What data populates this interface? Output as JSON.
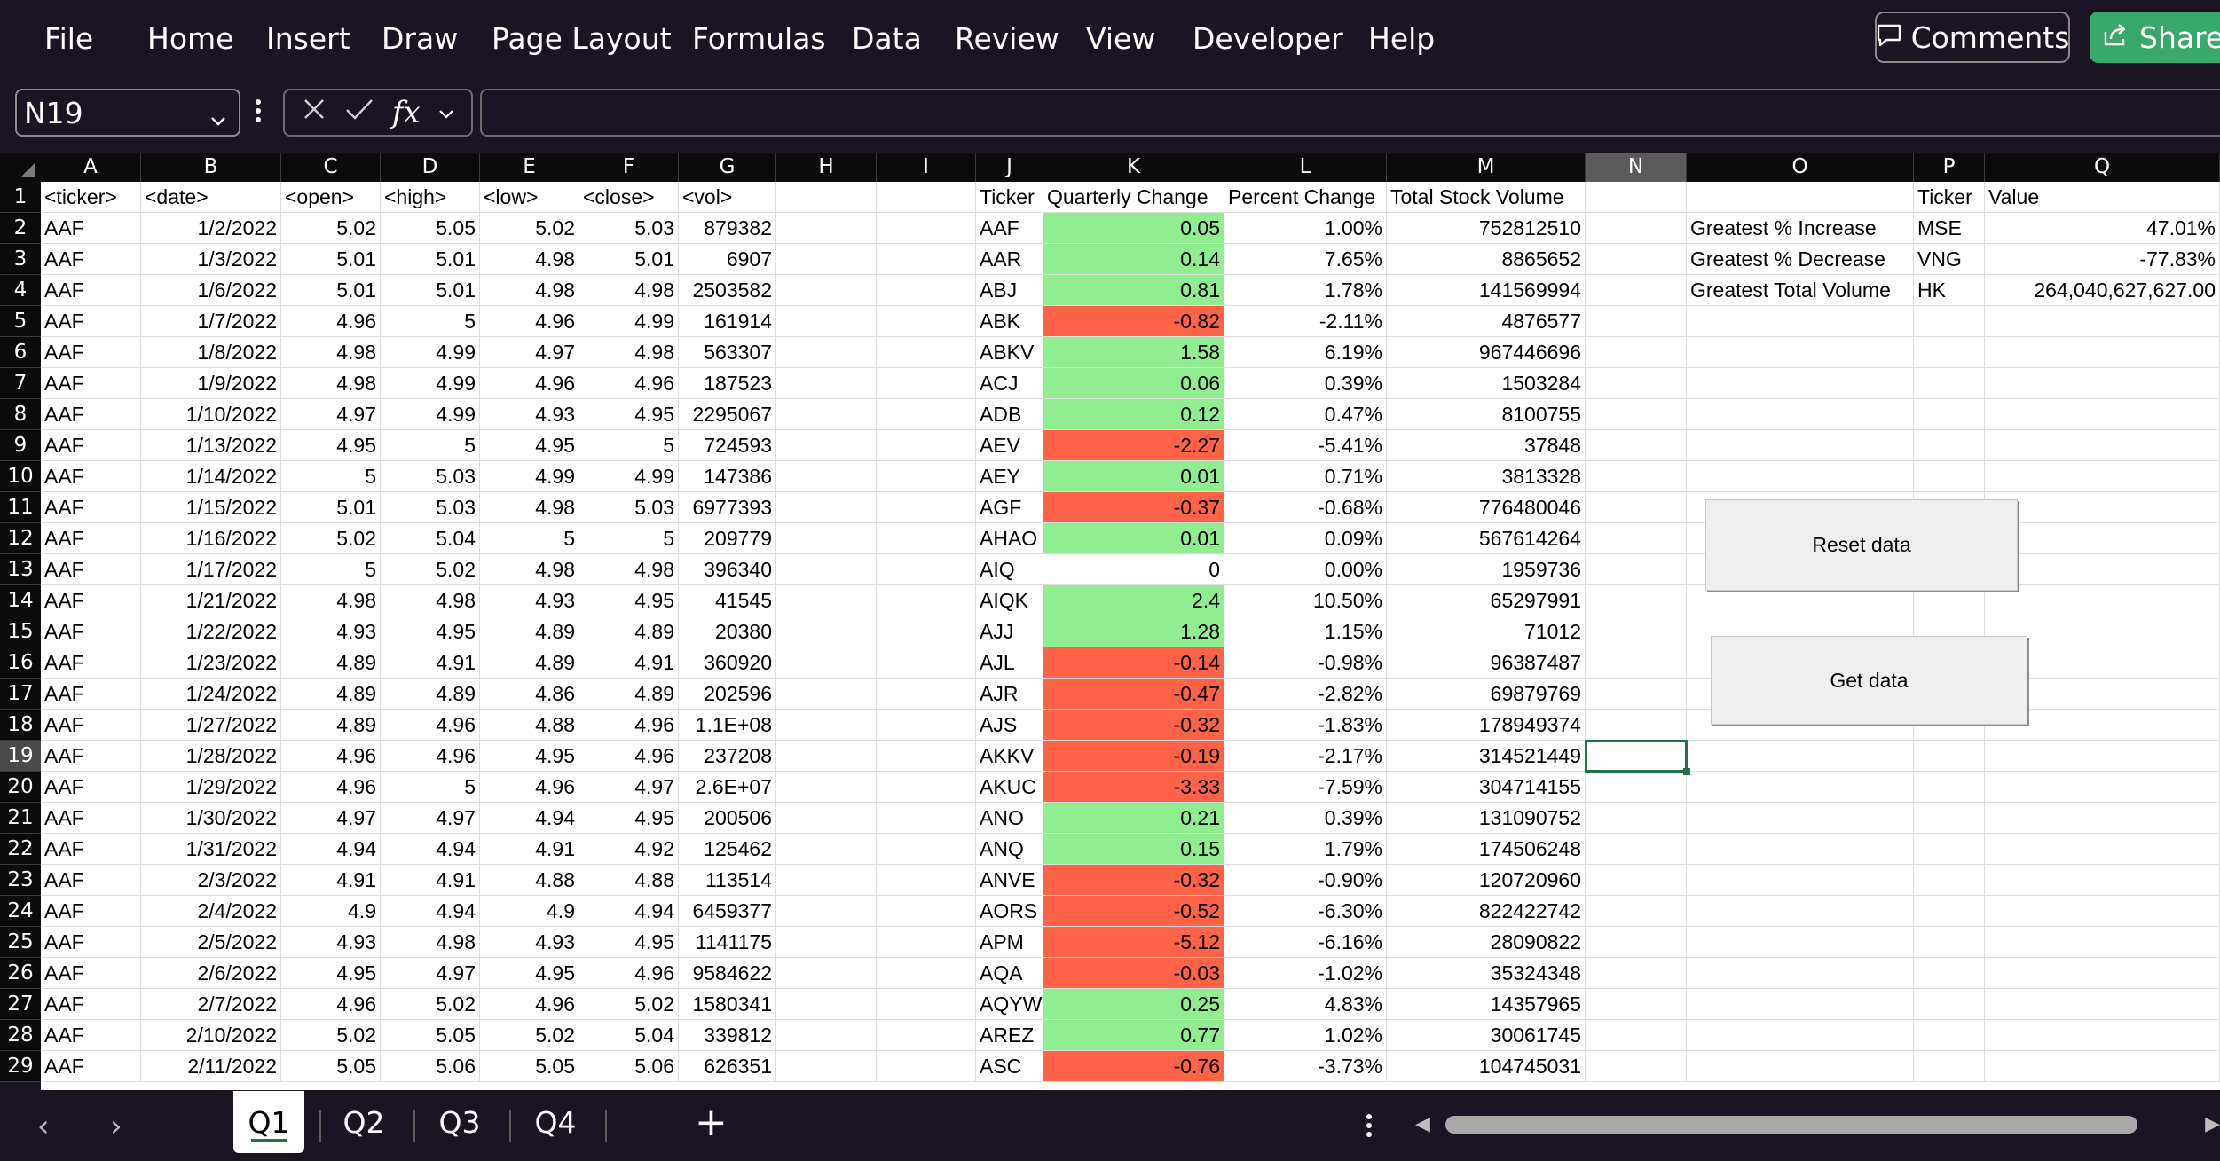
{
  "menu": [
    "File",
    "Home",
    "Insert",
    "Draw",
    "Page Layout",
    "Formulas",
    "Data",
    "Review",
    "View",
    "Developer",
    "Help"
  ],
  "comments_label": "Comments",
  "share_label": "Share",
  "namebox": "N19",
  "formula_value": "",
  "columns": [
    "A",
    "B",
    "C",
    "D",
    "E",
    "F",
    "G",
    "H",
    "I",
    "J",
    "K",
    "L",
    "M",
    "N",
    "O",
    "P",
    "Q"
  ],
  "selected_column": "N",
  "selected_row": 19,
  "rows": [
    {
      "n": 1,
      "A": "<ticker>",
      "B": "<date>",
      "C": "<open>",
      "D": "<high>",
      "E": "<low>",
      "F": "<close>",
      "G": "<vol>",
      "J": "Ticker",
      "K": "Quarterly Change",
      "L": "Percent Change",
      "M": "Total Stock Volume",
      "P": "Ticker",
      "Q": "Value"
    },
    {
      "n": 2,
      "A": "AAF",
      "B": "1/2/2022",
      "C": "5.02",
      "D": "5.05",
      "E": "5.02",
      "F": "5.03",
      "G": "879382",
      "J": "AAF",
      "K": "0.05",
      "L": "1.00%",
      "M": "752812510",
      "O": "Greatest % Increase",
      "P": "MSE",
      "Q": "47.01%"
    },
    {
      "n": 3,
      "A": "AAF",
      "B": "1/3/2022",
      "C": "5.01",
      "D": "5.01",
      "E": "4.98",
      "F": "5.01",
      "G": "6907",
      "J": "AAR",
      "K": "0.14",
      "L": "7.65%",
      "M": "8865652",
      "O": "Greatest % Decrease",
      "P": "VNG",
      "Q": "-77.83%"
    },
    {
      "n": 4,
      "A": "AAF",
      "B": "1/6/2022",
      "C": "5.01",
      "D": "5.01",
      "E": "4.98",
      "F": "4.98",
      "G": "2503582",
      "J": "ABJ",
      "K": "0.81",
      "L": "1.78%",
      "M": "141569994",
      "O": "Greatest Total Volume",
      "P": "HK",
      "Q": "264,040,627,627.00"
    },
    {
      "n": 5,
      "A": "AAF",
      "B": "1/7/2022",
      "C": "4.96",
      "D": "5",
      "E": "4.96",
      "F": "4.99",
      "G": "161914",
      "J": "ABK",
      "K": "-0.82",
      "L": "-2.11%",
      "M": "4876577"
    },
    {
      "n": 6,
      "A": "AAF",
      "B": "1/8/2022",
      "C": "4.98",
      "D": "4.99",
      "E": "4.97",
      "F": "4.98",
      "G": "563307",
      "J": "ABKV",
      "K": "1.58",
      "L": "6.19%",
      "M": "967446696"
    },
    {
      "n": 7,
      "A": "AAF",
      "B": "1/9/2022",
      "C": "4.98",
      "D": "4.99",
      "E": "4.96",
      "F": "4.96",
      "G": "187523",
      "J": "ACJ",
      "K": "0.06",
      "L": "0.39%",
      "M": "1503284"
    },
    {
      "n": 8,
      "A": "AAF",
      "B": "1/10/2022",
      "C": "4.97",
      "D": "4.99",
      "E": "4.93",
      "F": "4.95",
      "G": "2295067",
      "J": "ADB",
      "K": "0.12",
      "L": "0.47%",
      "M": "8100755"
    },
    {
      "n": 9,
      "A": "AAF",
      "B": "1/13/2022",
      "C": "4.95",
      "D": "5",
      "E": "4.95",
      "F": "5",
      "G": "724593",
      "J": "AEV",
      "K": "-2.27",
      "L": "-5.41%",
      "M": "37848"
    },
    {
      "n": 10,
      "A": "AAF",
      "B": "1/14/2022",
      "C": "5",
      "D": "5.03",
      "E": "4.99",
      "F": "4.99",
      "G": "147386",
      "J": "AEY",
      "K": "0.01",
      "L": "0.71%",
      "M": "3813328"
    },
    {
      "n": 11,
      "A": "AAF",
      "B": "1/15/2022",
      "C": "5.01",
      "D": "5.03",
      "E": "4.98",
      "F": "5.03",
      "G": "6977393",
      "J": "AGF",
      "K": "-0.37",
      "L": "-0.68%",
      "M": "776480046"
    },
    {
      "n": 12,
      "A": "AAF",
      "B": "1/16/2022",
      "C": "5.02",
      "D": "5.04",
      "E": "5",
      "F": "5",
      "G": "209779",
      "J": "AHAO",
      "K": "0.01",
      "L": "0.09%",
      "M": "567614264"
    },
    {
      "n": 13,
      "A": "AAF",
      "B": "1/17/2022",
      "C": "5",
      "D": "5.02",
      "E": "4.98",
      "F": "4.98",
      "G": "396340",
      "J": "AIQ",
      "K": "0",
      "L": "0.00%",
      "M": "1959736"
    },
    {
      "n": 14,
      "A": "AAF",
      "B": "1/21/2022",
      "C": "4.98",
      "D": "4.98",
      "E": "4.93",
      "F": "4.95",
      "G": "41545",
      "J": "AIQK",
      "K": "2.4",
      "L": "10.50%",
      "M": "65297991"
    },
    {
      "n": 15,
      "A": "AAF",
      "B": "1/22/2022",
      "C": "4.93",
      "D": "4.95",
      "E": "4.89",
      "F": "4.89",
      "G": "20380",
      "J": "AJJ",
      "K": "1.28",
      "L": "1.15%",
      "M": "71012"
    },
    {
      "n": 16,
      "A": "AAF",
      "B": "1/23/2022",
      "C": "4.89",
      "D": "4.91",
      "E": "4.89",
      "F": "4.91",
      "G": "360920",
      "J": "AJL",
      "K": "-0.14",
      "L": "-0.98%",
      "M": "96387487"
    },
    {
      "n": 17,
      "A": "AAF",
      "B": "1/24/2022",
      "C": "4.89",
      "D": "4.89",
      "E": "4.86",
      "F": "4.89",
      "G": "202596",
      "J": "AJR",
      "K": "-0.47",
      "L": "-2.82%",
      "M": "69879769"
    },
    {
      "n": 18,
      "A": "AAF",
      "B": "1/27/2022",
      "C": "4.89",
      "D": "4.96",
      "E": "4.88",
      "F": "4.96",
      "G": "1.1E+08",
      "J": "AJS",
      "K": "-0.32",
      "L": "-1.83%",
      "M": "178949374"
    },
    {
      "n": 19,
      "A": "AAF",
      "B": "1/28/2022",
      "C": "4.96",
      "D": "4.96",
      "E": "4.95",
      "F": "4.96",
      "G": "237208",
      "J": "AKKV",
      "K": "-0.19",
      "L": "-2.17%",
      "M": "314521449"
    },
    {
      "n": 20,
      "A": "AAF",
      "B": "1/29/2022",
      "C": "4.96",
      "D": "5",
      "E": "4.96",
      "F": "4.97",
      "G": "2.6E+07",
      "J": "AKUC",
      "K": "-3.33",
      "L": "-7.59%",
      "M": "304714155"
    },
    {
      "n": 21,
      "A": "AAF",
      "B": "1/30/2022",
      "C": "4.97",
      "D": "4.97",
      "E": "4.94",
      "F": "4.95",
      "G": "200506",
      "J": "ANO",
      "K": "0.21",
      "L": "0.39%",
      "M": "131090752"
    },
    {
      "n": 22,
      "A": "AAF",
      "B": "1/31/2022",
      "C": "4.94",
      "D": "4.94",
      "E": "4.91",
      "F": "4.92",
      "G": "125462",
      "J": "ANQ",
      "K": "0.15",
      "L": "1.79%",
      "M": "174506248"
    },
    {
      "n": 23,
      "A": "AAF",
      "B": "2/3/2022",
      "C": "4.91",
      "D": "4.91",
      "E": "4.88",
      "F": "4.88",
      "G": "113514",
      "J": "ANVE",
      "K": "-0.32",
      "L": "-0.90%",
      "M": "120720960"
    },
    {
      "n": 24,
      "A": "AAF",
      "B": "2/4/2022",
      "C": "4.9",
      "D": "4.94",
      "E": "4.9",
      "F": "4.94",
      "G": "6459377",
      "J": "AORS",
      "K": "-0.52",
      "L": "-6.30%",
      "M": "822422742"
    },
    {
      "n": 25,
      "A": "AAF",
      "B": "2/5/2022",
      "C": "4.93",
      "D": "4.98",
      "E": "4.93",
      "F": "4.95",
      "G": "1141175",
      "J": "APM",
      "K": "-5.12",
      "L": "-6.16%",
      "M": "28090822"
    },
    {
      "n": 26,
      "A": "AAF",
      "B": "2/6/2022",
      "C": "4.95",
      "D": "4.97",
      "E": "4.95",
      "F": "4.96",
      "G": "9584622",
      "J": "AQA",
      "K": "-0.03",
      "L": "-1.02%",
      "M": "35324348"
    },
    {
      "n": 27,
      "A": "AAF",
      "B": "2/7/2022",
      "C": "4.96",
      "D": "5.02",
      "E": "4.96",
      "F": "5.02",
      "G": "1580341",
      "J": "AQYW",
      "K": "0.25",
      "L": "4.83%",
      "M": "14357965"
    },
    {
      "n": 28,
      "A": "AAF",
      "B": "2/10/2022",
      "C": "5.02",
      "D": "5.05",
      "E": "5.02",
      "F": "5.04",
      "G": "339812",
      "J": "AREZ",
      "K": "0.77",
      "L": "1.02%",
      "M": "30061745"
    },
    {
      "n": 29,
      "A": "AAF",
      "B": "2/11/2022",
      "C": "5.05",
      "D": "5.06",
      "E": "5.05",
      "F": "5.06",
      "G": "626351",
      "J": "ASC",
      "K": "-0.76",
      "L": "-3.73%",
      "M": "104745031"
    }
  ],
  "buttons": {
    "reset": "Reset data",
    "get": "Get data"
  },
  "sheet_tabs": [
    "Q1",
    "Q2",
    "Q3",
    "Q4"
  ],
  "active_sheet": "Q1",
  "colors": {
    "positive": "#90ee90",
    "negative": "#ff6347",
    "neutral": "#ffffff",
    "accent": "#217346",
    "share": "#3aa76d"
  },
  "icons": [
    "comment-icon",
    "share-icon",
    "chevron-down-icon",
    "more-options-icon",
    "cancel-icon",
    "enter-icon",
    "function-icon",
    "select-all-icon",
    "scroll-left-icon",
    "scroll-right-icon",
    "add-sheet-icon"
  ]
}
